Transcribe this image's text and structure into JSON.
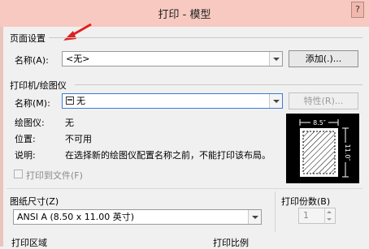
{
  "window": {
    "title": "打印 - 模型",
    "help": "?"
  },
  "page_setup": {
    "section": "页面设置",
    "name_label": "名称(A):",
    "name_value": "<无>",
    "add_button": "添加(.)..."
  },
  "printer": {
    "section": "打印机/绘图仪",
    "name_label": "名称(M):",
    "name_value": "无",
    "properties_button": "特性(R)...",
    "plotter_label": "绘图仪:",
    "plotter_value": "无",
    "location_label": "位置:",
    "location_value": "不可用",
    "description_label": "说明:",
    "description_value": "在选择新的绘图仪配置名称之前，不能打印该布局。",
    "print_to_file": "打印到文件(F)"
  },
  "preview": {
    "width_label": "8.5″",
    "height_label": "11.0″"
  },
  "paper_size": {
    "section": "图纸尺寸(Z)",
    "value": "ANSI A (8.50 x 11.00 英寸)"
  },
  "copies": {
    "label": "打印份数(B)",
    "value": "1"
  },
  "bottom": {
    "plot_area": "打印区域",
    "plot_scale": "打印比例"
  }
}
